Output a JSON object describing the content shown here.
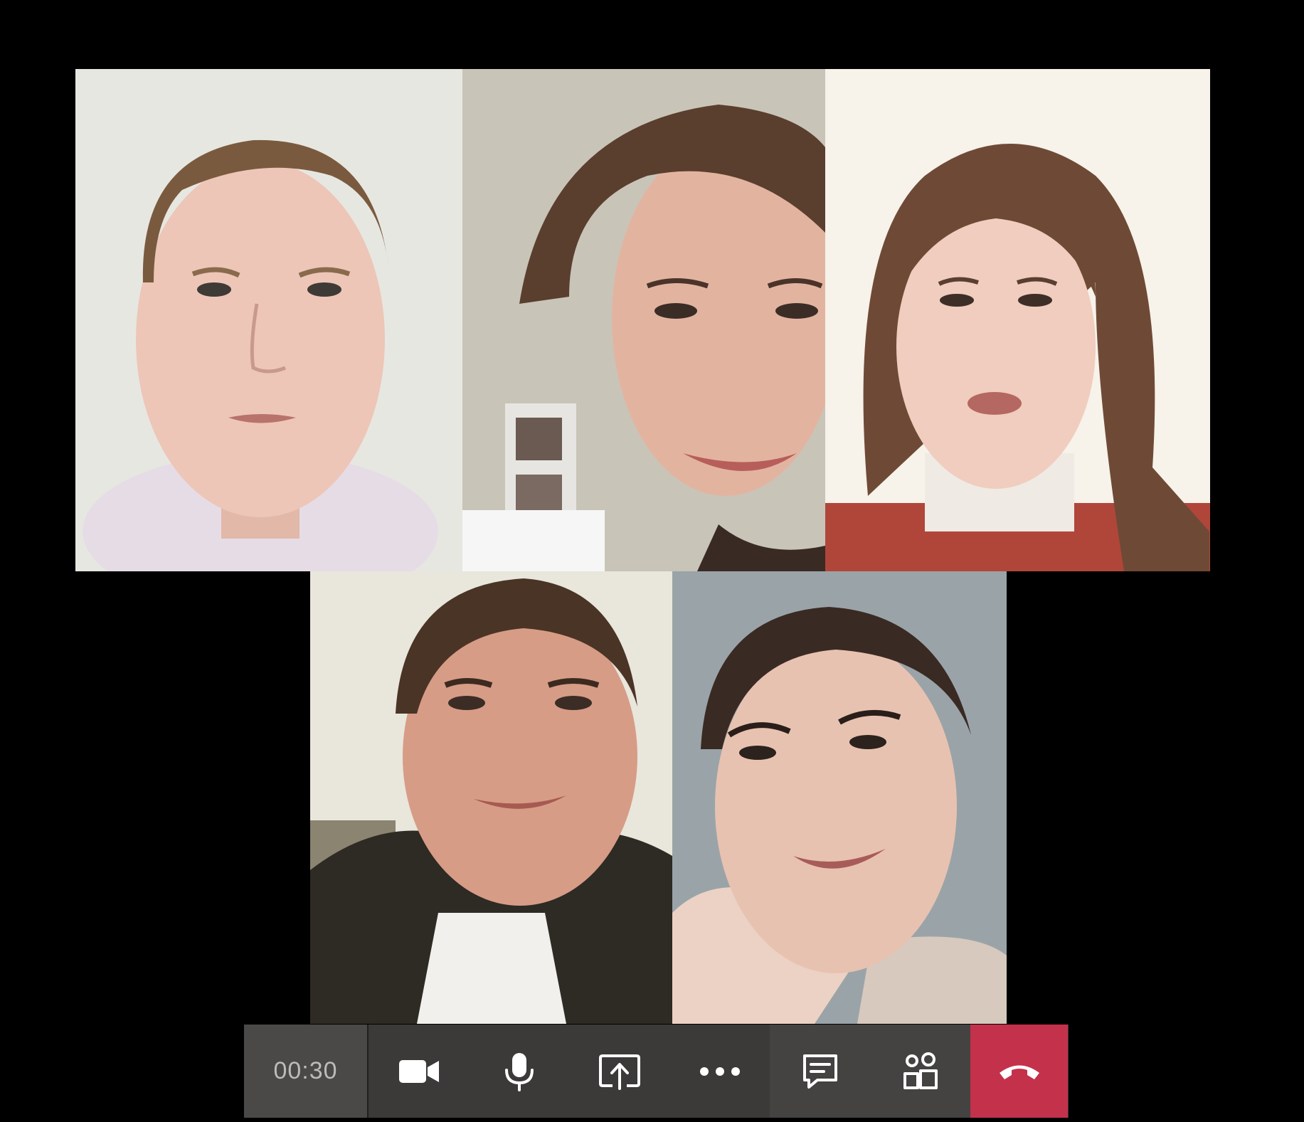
{
  "call": {
    "timer": "00:30"
  },
  "participants": [
    {
      "id": "participant-1",
      "shirt_color": "#e8dde6",
      "background": "#ecebe6"
    },
    {
      "id": "participant-2",
      "shirt_color": "#f4f4f4",
      "background": "#c9c4b8"
    },
    {
      "id": "participant-3",
      "shirt_color": "#b0463a",
      "background": "#f7f2ea"
    },
    {
      "id": "participant-4",
      "shirt_color": "#2e2a24",
      "background": "#e9e6dc"
    },
    {
      "id": "participant-5",
      "shirt_color": "#d7c9bd",
      "background": "#9aa4a8"
    }
  ],
  "toolbar": {
    "buttons": [
      {
        "name": "camera",
        "icon": "video-camera-icon"
      },
      {
        "name": "microphone",
        "icon": "microphone-icon"
      },
      {
        "name": "share",
        "icon": "share-screen-icon"
      },
      {
        "name": "more",
        "icon": "more-options-icon"
      },
      {
        "name": "chat",
        "icon": "chat-icon"
      },
      {
        "name": "participants",
        "icon": "people-icon"
      },
      {
        "name": "hang-up",
        "icon": "hang-up-icon"
      }
    ]
  },
  "colors": {
    "toolbar_bg": "#3b3a39",
    "timer_bg": "#4a4948",
    "hangup": "#c4314b",
    "icon": "#ffffff",
    "page_bg": "#000000"
  }
}
